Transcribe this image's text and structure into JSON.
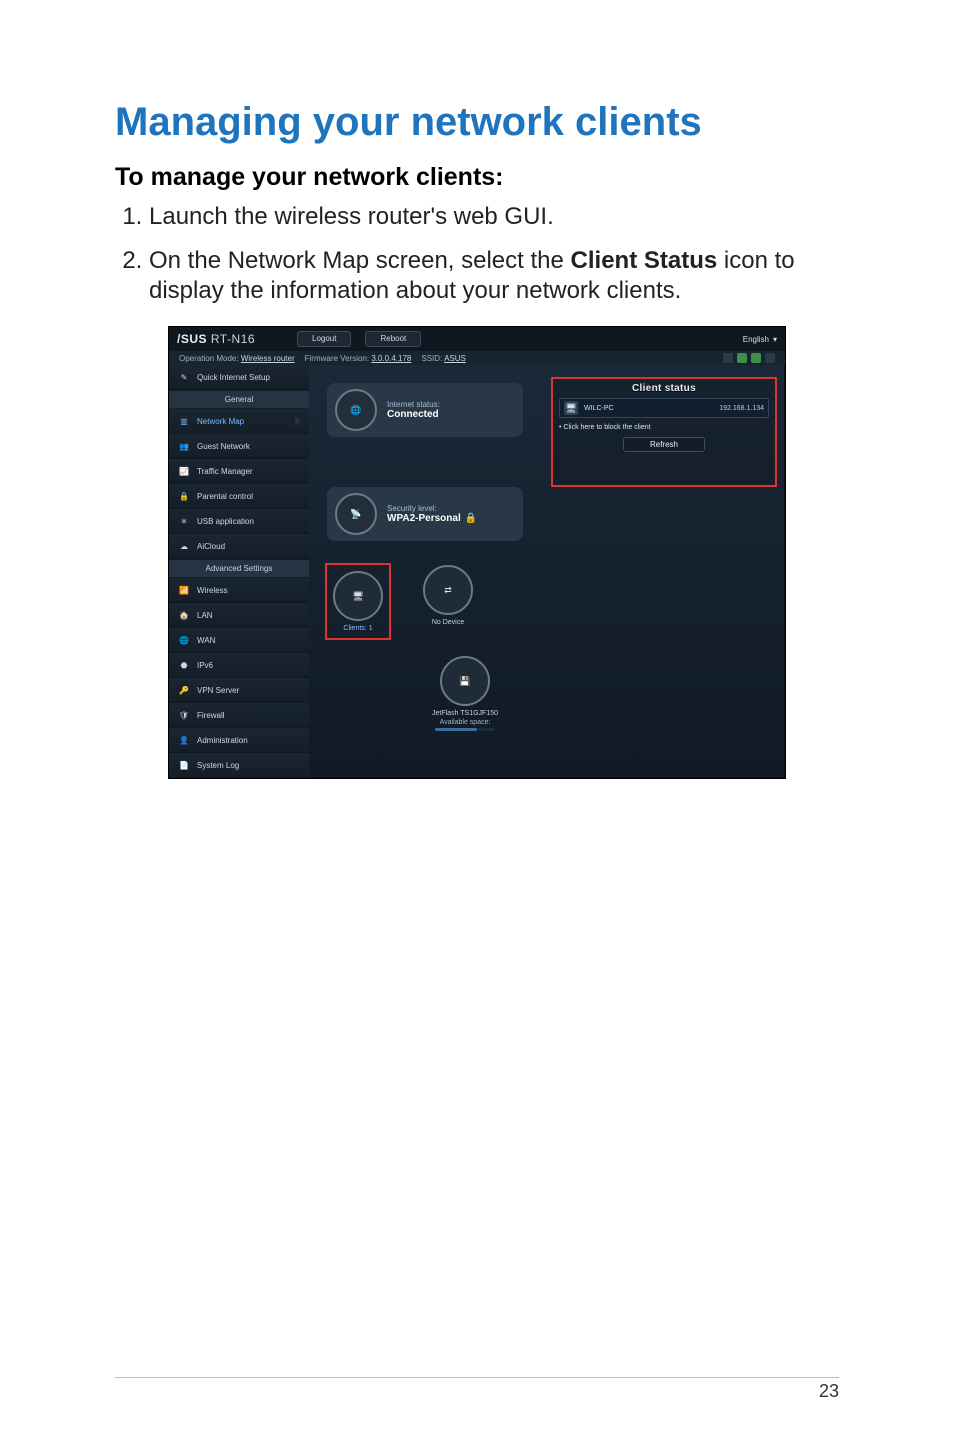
{
  "page": {
    "number": "23",
    "title": "Managing your network clients",
    "subtitle": "To manage your network clients:",
    "steps": [
      {
        "text": "Launch the wireless router's web GUI."
      },
      {
        "before": "On the Network Map screen, select the ",
        "bold": "Client Status",
        "after": " icon to display the information about your network clients."
      }
    ]
  },
  "router": {
    "brand": "/SUS",
    "model": "RT-N16",
    "logout": "Logout",
    "reboot": "Reboot",
    "language": "English",
    "infoline": {
      "op_mode_label": "Operation Mode:",
      "op_mode": "Wireless router",
      "fw_label": "Firmware Version:",
      "fw": "3.0.0.4.178",
      "ssid_label": "SSID:",
      "ssid": "ASUS"
    },
    "sidebar": {
      "general_header": "General",
      "advanced_header": "Advanced Settings",
      "items_general": [
        {
          "name": "quick-internet-setup",
          "label": "Quick Internet Setup",
          "icon": "wand-icon"
        },
        {
          "name": "network-map",
          "label": "Network Map",
          "icon": "diagram-icon",
          "active": true
        },
        {
          "name": "guest-network",
          "label": "Guest Network",
          "icon": "users-icon"
        },
        {
          "name": "traffic-manager",
          "label": "Traffic Manager",
          "icon": "chart-icon"
        },
        {
          "name": "parental-control",
          "label": "Parental control",
          "icon": "lock-icon"
        },
        {
          "name": "usb-application",
          "label": "USB application",
          "icon": "usb-icon"
        },
        {
          "name": "aicloud",
          "label": "AiCloud",
          "icon": "cloud-icon"
        }
      ],
      "items_advanced": [
        {
          "name": "wireless",
          "label": "Wireless",
          "icon": "wifi-icon"
        },
        {
          "name": "lan",
          "label": "LAN",
          "icon": "home-icon"
        },
        {
          "name": "wan",
          "label": "WAN",
          "icon": "globe-icon"
        },
        {
          "name": "ipv6",
          "label": "IPv6",
          "icon": "ipv6-icon"
        },
        {
          "name": "vpn-server",
          "label": "VPN Server",
          "icon": "vpn-icon"
        },
        {
          "name": "firewall",
          "label": "Firewall",
          "icon": "shield-icon"
        },
        {
          "name": "administration",
          "label": "Administration",
          "icon": "admin-icon"
        },
        {
          "name": "system-log",
          "label": "System Log",
          "icon": "log-icon"
        }
      ]
    },
    "main": {
      "internet_status_label": "Internet status:",
      "internet_status_value": "Connected",
      "security_label": "Security level:",
      "security_value": "WPA2-Personal",
      "clients_label": "Clients:",
      "clients_count": "1",
      "no_device": "No Device",
      "usb_name": "JetFlash TS1GJF150",
      "usb_free_label": "Available space:"
    },
    "client_panel": {
      "title": "Client status",
      "client_name": "WILC-PC",
      "client_ip": "192.168.1.134",
      "block_link": "Click here to block the client",
      "refresh": "Refresh"
    }
  }
}
